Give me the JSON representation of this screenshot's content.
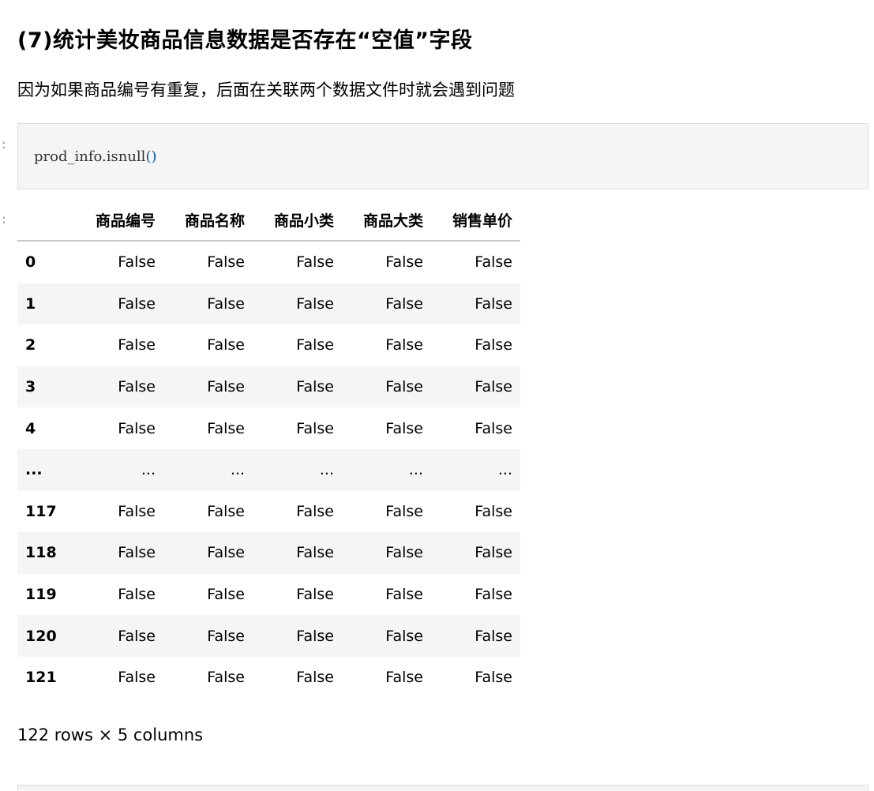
{
  "markdown": {
    "heading": "(7)统计美妆商品信息数据是否存在“空值”字段",
    "description": "因为如果商品编号有重复，后面在关联两个数据文件时就会遇到问题"
  },
  "code_cell": {
    "prompt": ":",
    "code_prefix": "prod_info.isnull",
    "code_parens": "()"
  },
  "output_cell": {
    "prompt": ":",
    "dataframe": {
      "columns": [
        "商品编号",
        "商品名称",
        "商品小类",
        "商品大类",
        "销售单价"
      ],
      "rows": [
        {
          "index": "0",
          "values": [
            "False",
            "False",
            "False",
            "False",
            "False"
          ]
        },
        {
          "index": "1",
          "values": [
            "False",
            "False",
            "False",
            "False",
            "False"
          ]
        },
        {
          "index": "2",
          "values": [
            "False",
            "False",
            "False",
            "False",
            "False"
          ]
        },
        {
          "index": "3",
          "values": [
            "False",
            "False",
            "False",
            "False",
            "False"
          ]
        },
        {
          "index": "4",
          "values": [
            "False",
            "False",
            "False",
            "False",
            "False"
          ]
        },
        {
          "index": "...",
          "values": [
            "...",
            "...",
            "...",
            "...",
            "..."
          ]
        },
        {
          "index": "117",
          "values": [
            "False",
            "False",
            "False",
            "False",
            "False"
          ]
        },
        {
          "index": "118",
          "values": [
            "False",
            "False",
            "False",
            "False",
            "False"
          ]
        },
        {
          "index": "119",
          "values": [
            "False",
            "False",
            "False",
            "False",
            "False"
          ]
        },
        {
          "index": "120",
          "values": [
            "False",
            "False",
            "False",
            "False",
            "False"
          ]
        },
        {
          "index": "121",
          "values": [
            "False",
            "False",
            "False",
            "False",
            "False"
          ]
        }
      ],
      "shape_text": "122 rows × 5 columns"
    }
  },
  "colors": {
    "cell_background": "#f5f5f5",
    "cell_border": "#dcdcdc",
    "paren_color": "#0055aa",
    "prompt_color": "#9e9e9e"
  }
}
